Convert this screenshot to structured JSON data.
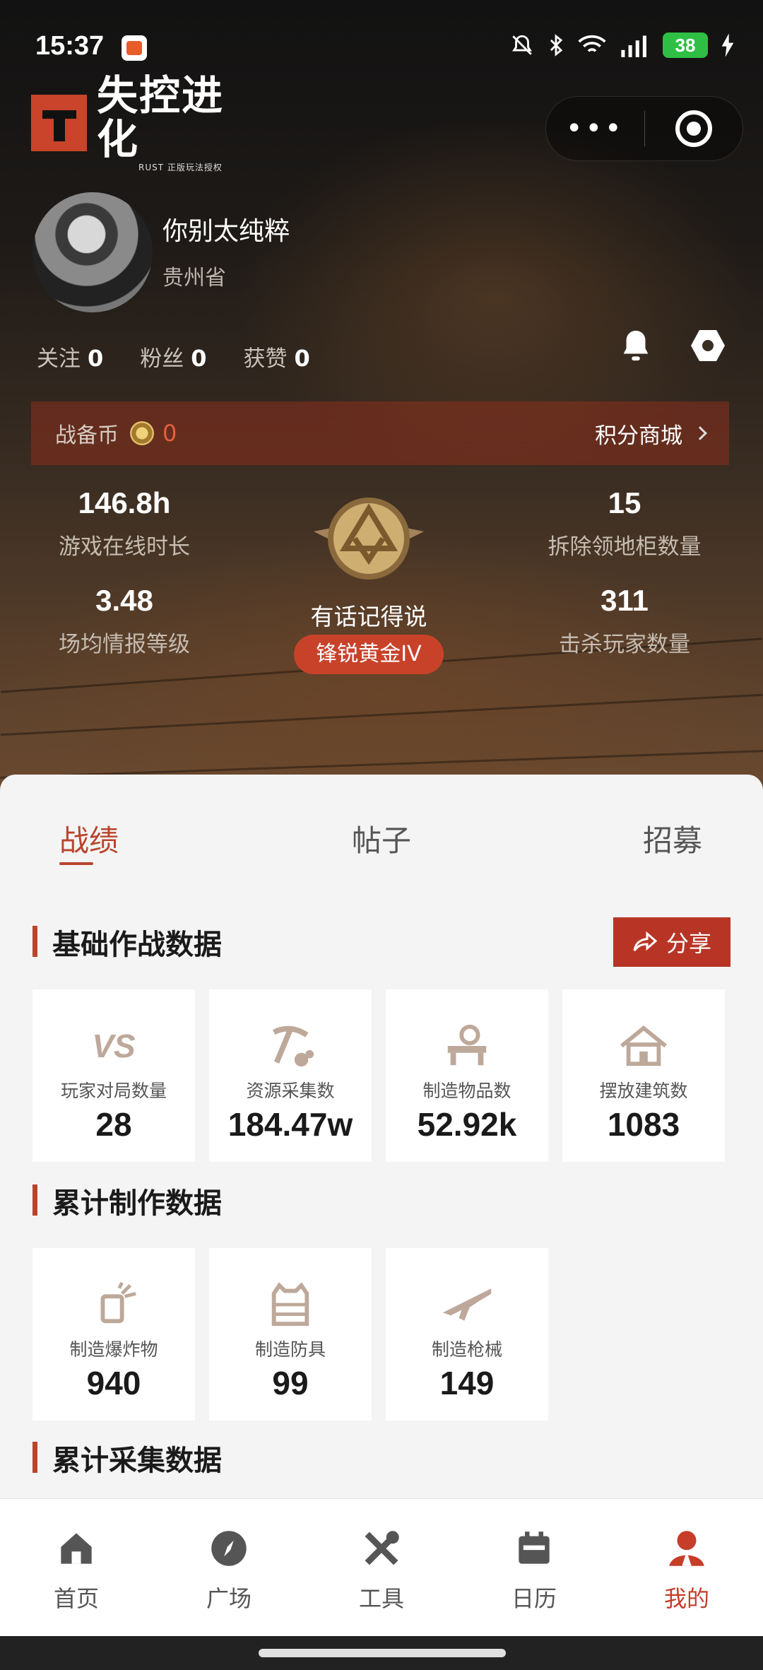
{
  "status_bar": {
    "time": "15:37",
    "battery": "38"
  },
  "app": {
    "logo_title": "失控进化",
    "logo_subtitle": "RUST 正版玩法授权"
  },
  "profile": {
    "username": "你别太纯粹",
    "province": "贵州省"
  },
  "counts": [
    {
      "label": "关注",
      "value": "0"
    },
    {
      "label": "粉丝",
      "value": "0"
    },
    {
      "label": "获赞",
      "value": "0"
    }
  ],
  "coin_bar": {
    "label": "战备币",
    "value": "0",
    "mall_label": "积分商城"
  },
  "stats": {
    "online_hours": {
      "value": "146.8h",
      "label": "游戏在线时长"
    },
    "intel_level": {
      "value": "3.48",
      "label": "场均情报等级"
    },
    "cabinets_removed": {
      "value": "15",
      "label": "拆除领地柜数量"
    },
    "players_killed": {
      "value": "311",
      "label": "击杀玩家数量"
    }
  },
  "rank": {
    "title": "有话记得说",
    "tier": "锋锐黄金IV"
  },
  "tabs": [
    "战绩",
    "帖子",
    "招募"
  ],
  "sections": {
    "basic": {
      "title": "基础作战数据",
      "share_label": "分享",
      "cards": [
        {
          "icon": "vs-icon",
          "icon_text": "VS",
          "label": "玩家对局数量",
          "value": "28"
        },
        {
          "icon": "pickaxe-icon",
          "label": "资源采集数",
          "value": "184.47w"
        },
        {
          "icon": "workbench-icon",
          "label": "制造物品数",
          "value": "52.92k"
        },
        {
          "icon": "house-icon",
          "label": "摆放建筑数",
          "value": "1083"
        }
      ]
    },
    "crafting": {
      "title": "累计制作数据",
      "cards": [
        {
          "icon": "explosive-icon",
          "label": "制造爆炸物",
          "value": "940"
        },
        {
          "icon": "armor-vest-icon",
          "label": "制造防具",
          "value": "99"
        },
        {
          "icon": "rifle-icon",
          "label": "制造枪械",
          "value": "149"
        }
      ]
    },
    "gathering": {
      "title": "累计采集数据"
    }
  },
  "bottom_nav": [
    {
      "icon": "home-icon",
      "label": "首页"
    },
    {
      "icon": "compass-icon",
      "label": "广场"
    },
    {
      "icon": "tools-icon",
      "label": "工具"
    },
    {
      "icon": "calendar-icon",
      "label": "日历"
    },
    {
      "icon": "profile-icon",
      "label": "我的"
    }
  ],
  "colors": {
    "accent": "#c63d2a",
    "card_bg": "#ffffff",
    "page_bg": "#f4f4f4"
  }
}
